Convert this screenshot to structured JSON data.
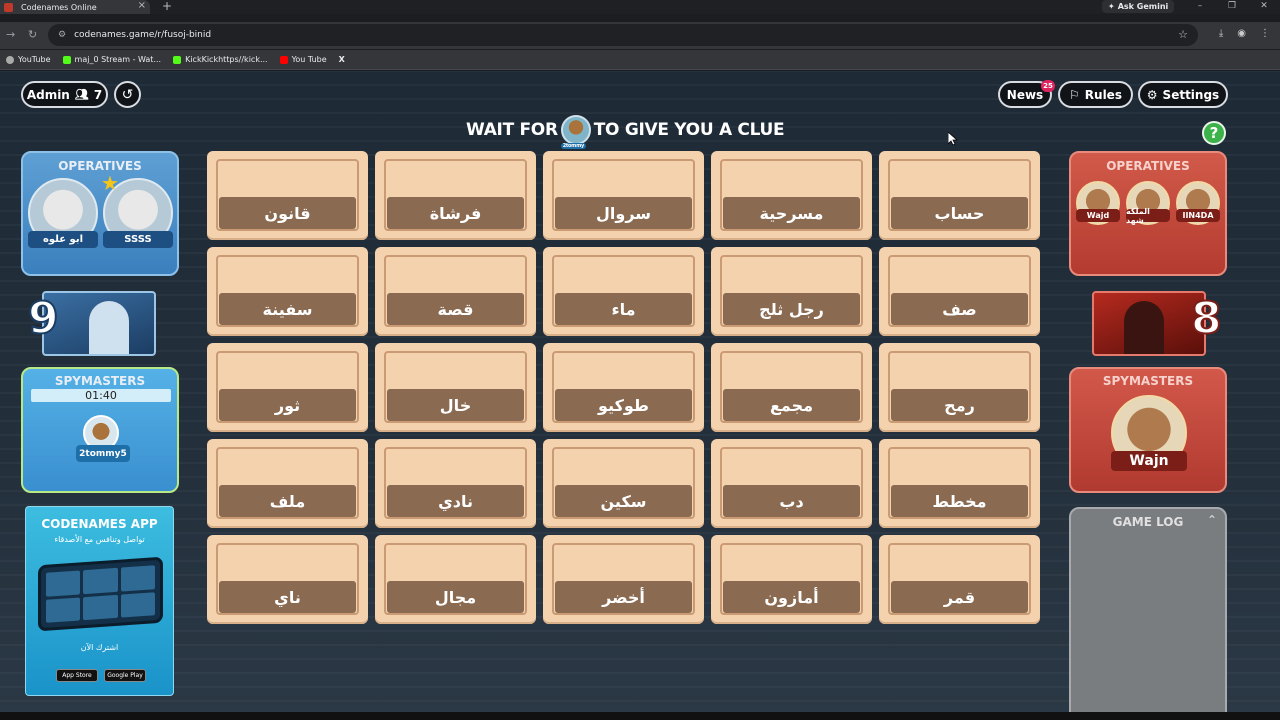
{
  "browser": {
    "tab_title": "Codenames Online",
    "url": "codenames.game/r/fusoj-binid",
    "ask_label": "Ask Gemini",
    "bookmarks": [
      "YouTube",
      "maj_0 Stream - Wat...",
      "KickKickhttps//kick...",
      "You Tube",
      "X"
    ]
  },
  "header": {
    "admin_label": "Admin",
    "player_count": "7",
    "news_label": "News",
    "news_badge": "25",
    "rules_label": "Rules",
    "settings_label": "Settings"
  },
  "headline": {
    "prefix": "WAIT FOR",
    "suffix": "TO GIVE YOU A CLUE",
    "spymaster_name": "2tommy"
  },
  "blue_team": {
    "operatives_title": "OPERATIVES",
    "operatives": [
      "ابو علوه",
      "SSSS"
    ],
    "score": "9",
    "spymasters_title": "SPYMASTERS",
    "timer": "01:40",
    "spymaster": "2tommy5"
  },
  "red_team": {
    "operatives_title": "OPERATIVES",
    "operatives": [
      "Wajd",
      "الملكه شهد",
      "IIN4DA"
    ],
    "score": "8",
    "spymasters_title": "SPYMASTERS",
    "spymaster": "Wajn"
  },
  "app_ad": {
    "title": "CODENAMES APP",
    "subtitle": "تواصل وتنافس مع الأصدقاء",
    "join": "اشترك الآن",
    "app_store": "App Store",
    "google_play": "Google Play"
  },
  "game_log": {
    "title": "GAME LOG"
  },
  "words": [
    "قانون",
    "فرشاة",
    "سروال",
    "مسرحية",
    "حساب",
    "سفينة",
    "قصة",
    "ماء",
    "رجل ثلج",
    "صف",
    "ثور",
    "خال",
    "طوكيو",
    "مجمع",
    "رمح",
    "ملف",
    "نادي",
    "سكين",
    "دب",
    "مخطط",
    "ناي",
    "مجال",
    "أخضر",
    "أمازون",
    "قمر"
  ]
}
